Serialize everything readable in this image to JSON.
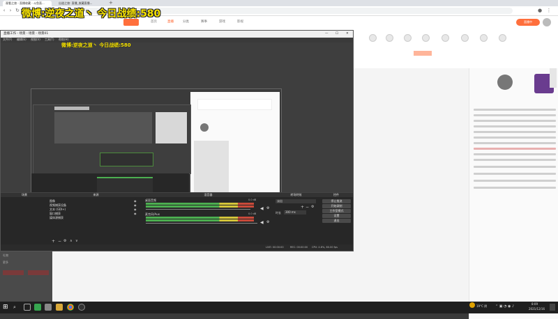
{
  "browser": {
    "tabs": [
      {
        "label": "观看之旅 - 直播收藏 - 斗鱼直..."
      },
      {
        "label": "出道之旅: 直播_收藏直播..."
      }
    ],
    "new_tab_symbol": "+"
  },
  "overlay": {
    "text": "微博:逆夜之道丶  今日战绩:580"
  },
  "site": {
    "nav": [
      "首页",
      "直播",
      "分类",
      "赛事",
      "游戏",
      "影视"
    ],
    "active_nav_index": 1,
    "live_badge": "直播中",
    "chat_lines": 14
  },
  "obs": {
    "title": "直播工作 - 场景 - 场景 - 场景01",
    "menu": [
      "文件(F)",
      "编辑(E)",
      "视图(V)",
      "工具(T)",
      "帮助(H)"
    ],
    "panels": {
      "scenes": "场景",
      "sources": "来源",
      "mixer": "混音器",
      "transitions": "转场特效",
      "controls": "控件"
    },
    "sources": [
      "图像",
      "视频捕获设备",
      "文本 (GDI+)",
      "窗口捕获",
      "媒体源捕获"
    ],
    "mixer_channels": [
      {
        "name": "桌面音频",
        "level_text": "0.0 dB"
      },
      {
        "name": "麦克风/Aux",
        "level_text": "0.0 dB"
      }
    ],
    "transition": {
      "type": "淡出",
      "duration_label": "时长",
      "duration_value": "300 ms"
    },
    "controls": [
      "停止推流",
      "开始录制",
      "工作室模式",
      "设置",
      "退出"
    ],
    "status": {
      "live_label": "LIVE: 00:00:00",
      "rec_label": "REC: 00:00:00",
      "cpu_label": "CPU: 4.6%, 60.00 fps"
    }
  },
  "left_panel": {
    "items": [
      "推荐功能",
      "添加",
      "礼物",
      "更多"
    ]
  },
  "taskbar": {
    "clock_time": "8:09",
    "clock_date": "2021/12/16",
    "weather": "19°C 阴",
    "apps": [
      "start",
      "search",
      "task-view",
      "explorer",
      "chat",
      "browser",
      "store",
      "obs"
    ]
  }
}
